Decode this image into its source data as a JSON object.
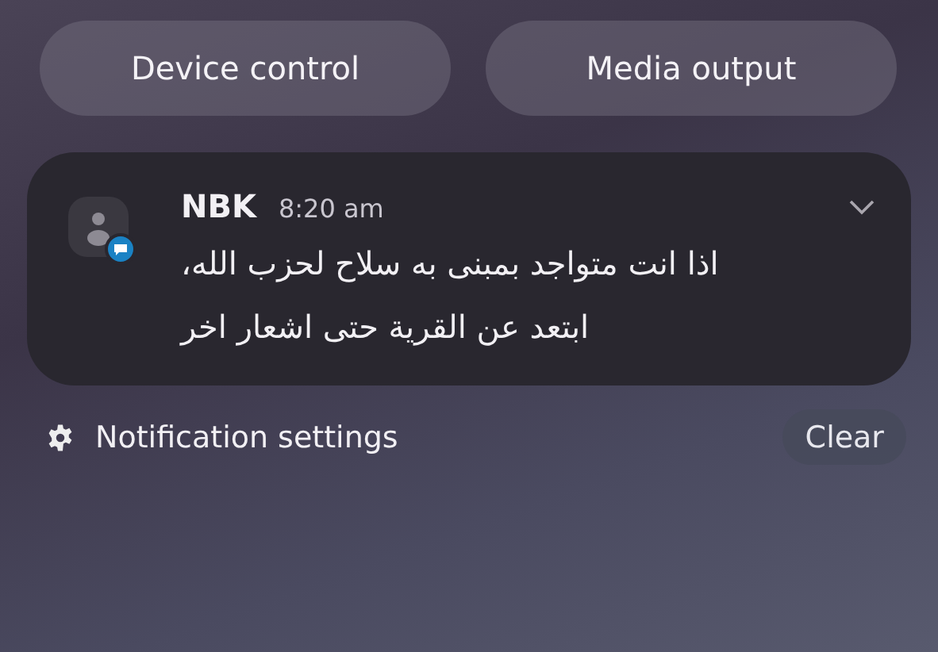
{
  "quick_buttons": [
    {
      "label": "Device control"
    },
    {
      "label": "Media output"
    }
  ],
  "notification": {
    "app": "NBK",
    "time": "8:20 am",
    "expanded": false,
    "message_lines": [
      "اذا انت متواجد بمبنى به سلاح لحزب الله،",
      "ابتعد عن القرية حتى اشعار اخر"
    ]
  },
  "footer": {
    "settings_label": "Notification settings",
    "clear_label": "Clear"
  }
}
